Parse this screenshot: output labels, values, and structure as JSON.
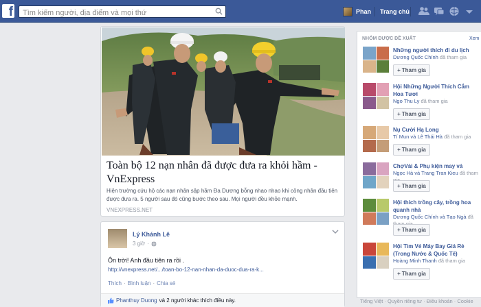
{
  "topbar": {
    "logo": "f",
    "search_placeholder": "Tìm kiếm người, địa điểm và mọi thứ",
    "user_name": "Phan",
    "home_label": "Trang chủ"
  },
  "story": {
    "title": "Toàn bộ 12 nạn nhân đã được đưa ra khỏi hầm - VnExpress",
    "description": "Hiện trường cứu hộ các nạn nhân sập hầm Đa Dương bỗng nhao nhao khi công nhân đầu tiên được đưa ra. 5 người sau đó cũng bước theo sau. Mọi người đều khỏe mạnh.",
    "source": "VNEXPRESS.NET"
  },
  "post": {
    "author": "Lý Khánh Lê",
    "time": "3 giờ",
    "text": "Ôn trời! Anh đầu tiên ra rồi .",
    "link": "http://vnexpress.net/.../toan-bo-12-nan-nhan-da-duoc-dua-ra-k...",
    "actions": {
      "like": "Thích",
      "comment": "Bình luận",
      "share": "Chia sẻ",
      "sep": "·"
    },
    "likes_name": "Phanthuy Duong",
    "likes_rest": "và 2 người khác thích điều này."
  },
  "suggested": {
    "header": "NHÓM ĐƯỢC ĐỀ XUẤT",
    "more": "Xem",
    "join_label": "Tham gia",
    "groups": [
      {
        "name": "Những người thích đi du lịch",
        "members": "Dương Quốc Chính",
        "suffix": " đã tham gia"
      },
      {
        "name": "Hội Những Người Thích Cắm Hoa Tươi",
        "members": "Ngo Thu Ly",
        "suffix": " đã tham gia"
      },
      {
        "name": "Nụ Cười Hạ Long",
        "members": "Tí Mun và Lê Thái Hà",
        "suffix": " đã tham gia"
      },
      {
        "name": "ChợVải & Phụ kiện may vá",
        "members": "Ngọc Hà và Trang Tran Kieu",
        "suffix": " đã tham gia"
      },
      {
        "name": "Hội thích trồng cây, trồng hoa quanh nhà",
        "members": "Dương Quốc Chính và Tạo Ngà",
        "suffix": " đã tham gia"
      },
      {
        "name": "Hội Tìm Vé Máy Bay Giá Rẻ (Trong Nước & Quốc Tế)",
        "members": "Hoàng Minh Thanh",
        "suffix": " đã tham gia"
      }
    ]
  },
  "footer": "Tiếng Việt · Quyền riêng tư · Điều khoản · Cookie"
}
